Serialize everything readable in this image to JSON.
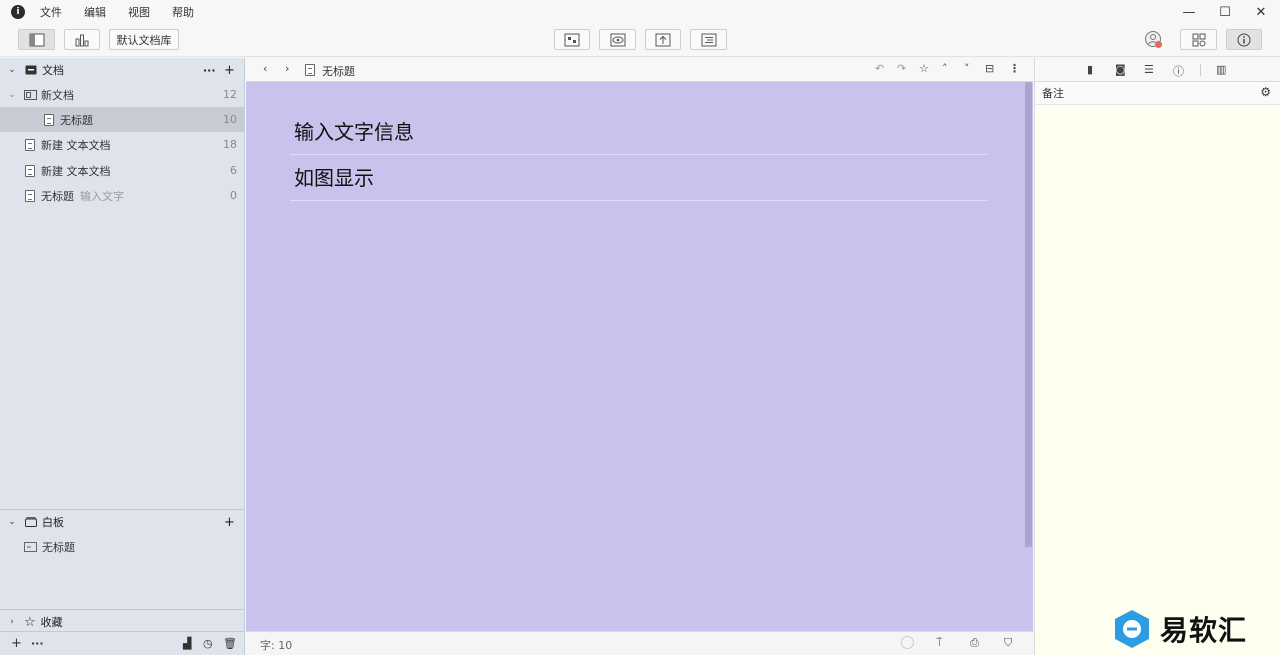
{
  "menu": [
    "文件",
    "编辑",
    "视图",
    "帮助"
  ],
  "toolbar": {
    "library_label": "默认文档库"
  },
  "sidebar": {
    "docs_section": "文档",
    "items": [
      {
        "label": "新文档",
        "count": "12"
      },
      {
        "label": "无标题",
        "count": "10"
      },
      {
        "label": "新建 文本文档",
        "count": "18"
      },
      {
        "label": "新建 文本文档",
        "count": "6"
      },
      {
        "label": "无标题",
        "hint": "输入文字",
        "count": "0"
      }
    ],
    "board_section": "白板",
    "board_items": [
      {
        "label": "无标题"
      }
    ],
    "favorites_section": "收藏"
  },
  "editor": {
    "breadcrumb": "无标题",
    "lines": [
      "输入文字信息",
      "如图显示"
    ],
    "word_count": "字: 10",
    "background": "#c8c2ec"
  },
  "right_panel": {
    "notes_label": "备注"
  },
  "watermark": {
    "text": "易软汇"
  }
}
